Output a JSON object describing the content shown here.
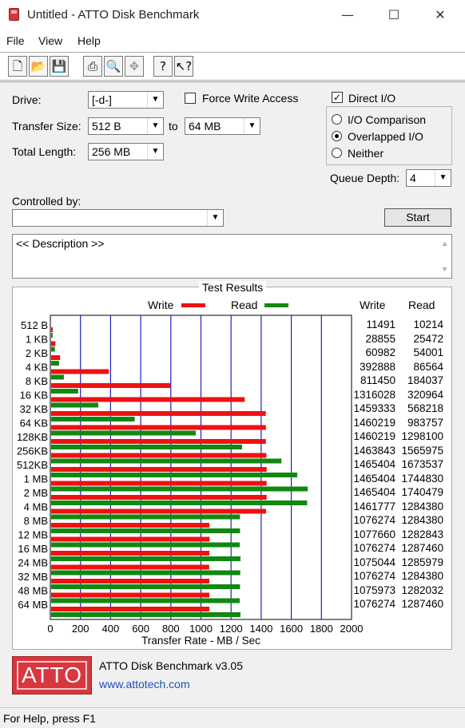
{
  "window": {
    "title": "Untitled - ATTO Disk Benchmark",
    "minimize": "—",
    "maximize": "☐",
    "close": "✕"
  },
  "menu": [
    "File",
    "View",
    "Help"
  ],
  "toolbar": [
    "new-icon",
    "open-icon",
    "save-icon",
    "print-icon",
    "print-preview-icon",
    "move-icon",
    "help-icon",
    "context-help-icon"
  ],
  "settings": {
    "drive_label": "Drive:",
    "drive_value": "[-d-]",
    "force_write_access_label": "Force Write Access",
    "force_write_access_checked": false,
    "direct_io_label": "Direct I/O",
    "direct_io_checked": true,
    "transfer_size_label": "Transfer Size:",
    "transfer_size_from": "512 B",
    "to_label": "to",
    "transfer_size_to": "64 MB",
    "total_length_label": "Total Length:",
    "total_length_value": "256 MB",
    "io_options": [
      "I/O Comparison",
      "Overlapped I/O",
      "Neither"
    ],
    "io_selected": "Overlapped I/O",
    "queue_depth_label": "Queue Depth:",
    "queue_depth_value": "4",
    "controlled_by_label": "Controlled by:",
    "controlled_by_value": "",
    "start_label": "Start",
    "description": "<< Description >>"
  },
  "results": {
    "title": "Test Results",
    "legend_write": "Write",
    "legend_read": "Read",
    "col_write": "Write",
    "col_read": "Read"
  },
  "chart_data": {
    "type": "bar",
    "orientation": "horizontal",
    "categories": [
      "512 B",
      "1 KB",
      "2 KB",
      "4 KB",
      "8 KB",
      "16 KB",
      "32 KB",
      "64 KB",
      "128KB",
      "256KB",
      "512KB",
      "1 MB",
      "2 MB",
      "4 MB",
      "8 MB",
      "12 MB",
      "16 MB",
      "24 MB",
      "32 MB",
      "48 MB",
      "64 MB"
    ],
    "series": [
      {
        "name": "Write",
        "color": "#ee1111",
        "values": [
          11.2,
          28.2,
          59.6,
          383.7,
          792.4,
          1285.2,
          1425.1,
          1425.9,
          1425.9,
          1429.5,
          1431.1,
          1431.1,
          1431.1,
          1427.5,
          1051.0,
          1052.4,
          1051.0,
          1049.8,
          1051.0,
          1050.8,
          1051.0
        ]
      },
      {
        "name": "Read",
        "color": "#118811",
        "values": [
          10.0,
          24.9,
          52.7,
          84.5,
          179.7,
          313.4,
          554.9,
          960.7,
          1267.7,
          1529.3,
          1634.4,
          1704.0,
          1699.7,
          1254.3,
          1254.3,
          1252.8,
          1257.3,
          1255.8,
          1254.3,
          1252.0,
          1257.3
        ]
      }
    ],
    "write_display": [
      "11491",
      "28855",
      "60982",
      "392888",
      "811450",
      "1316028",
      "1459333",
      "1460219",
      "1460219",
      "1463843",
      "1465404",
      "1465404",
      "1465404",
      "1461777",
      "1076274",
      "1077660",
      "1076274",
      "1075044",
      "1076274",
      "1075973",
      "1076274"
    ],
    "read_display": [
      "10214",
      "25472",
      "54001",
      "86564",
      "184037",
      "320964",
      "568218",
      "983757",
      "1298100",
      "1565975",
      "1673537",
      "1744830",
      "1740479",
      "1284380",
      "1284380",
      "1282843",
      "1287460",
      "1285979",
      "1284380",
      "1282032",
      "1287460"
    ],
    "x_ticks": [
      "0",
      "200",
      "400",
      "600",
      "800",
      "1000",
      "1200",
      "1400",
      "1600",
      "1800",
      "2000"
    ],
    "xlim": [
      0,
      2000
    ],
    "xlabel": "Transfer Rate - MB / Sec",
    "grid": true
  },
  "about": {
    "logo_text": "ATTO",
    "product": "ATTO Disk Benchmark v3.05",
    "url": "www.attotech.com"
  },
  "status": "For Help, press F1"
}
